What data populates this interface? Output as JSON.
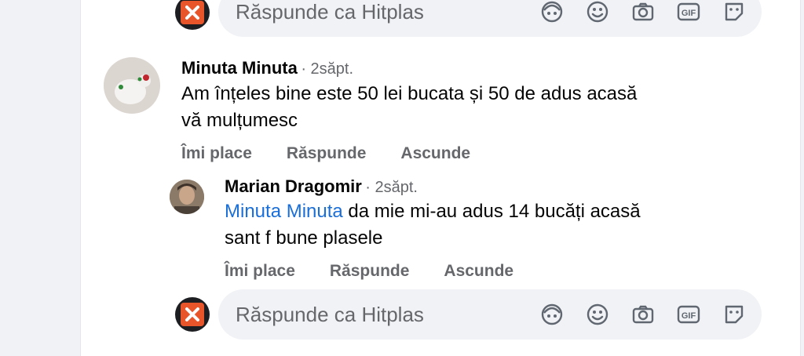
{
  "reply_placeholder": "Răspunde ca Hitplas",
  "reply_icons": [
    "avatar-sticker-icon",
    "emoji-icon",
    "camera-icon",
    "gif-icon",
    "sticker-icon"
  ],
  "gif_label": "GIF",
  "colors": {
    "accent": "#1a6ed8",
    "secondary_text": "#65676b",
    "input_bg": "#f0f2f5",
    "brand": "#e8552b"
  },
  "comments": [
    {
      "author": "Minuta Minuta",
      "time": "· 2săpt.",
      "text_line1": "Am înțeles bine este 50 lei bucata și 50 de adus acasă",
      "text_line2": "vă mulțumesc",
      "actions": [
        "Îmi place",
        "Răspunde",
        "Ascunde"
      ]
    },
    {
      "author": "Marian Dragomir",
      "time": "· 2săpt.",
      "mention": "Minuta Minuta",
      "text_line1_rest": " da mie mi-au adus 14 bucăți acasă",
      "text_line2": "sant f bune plasele",
      "actions": [
        "Îmi place",
        "Răspunde",
        "Ascunde"
      ]
    }
  ]
}
